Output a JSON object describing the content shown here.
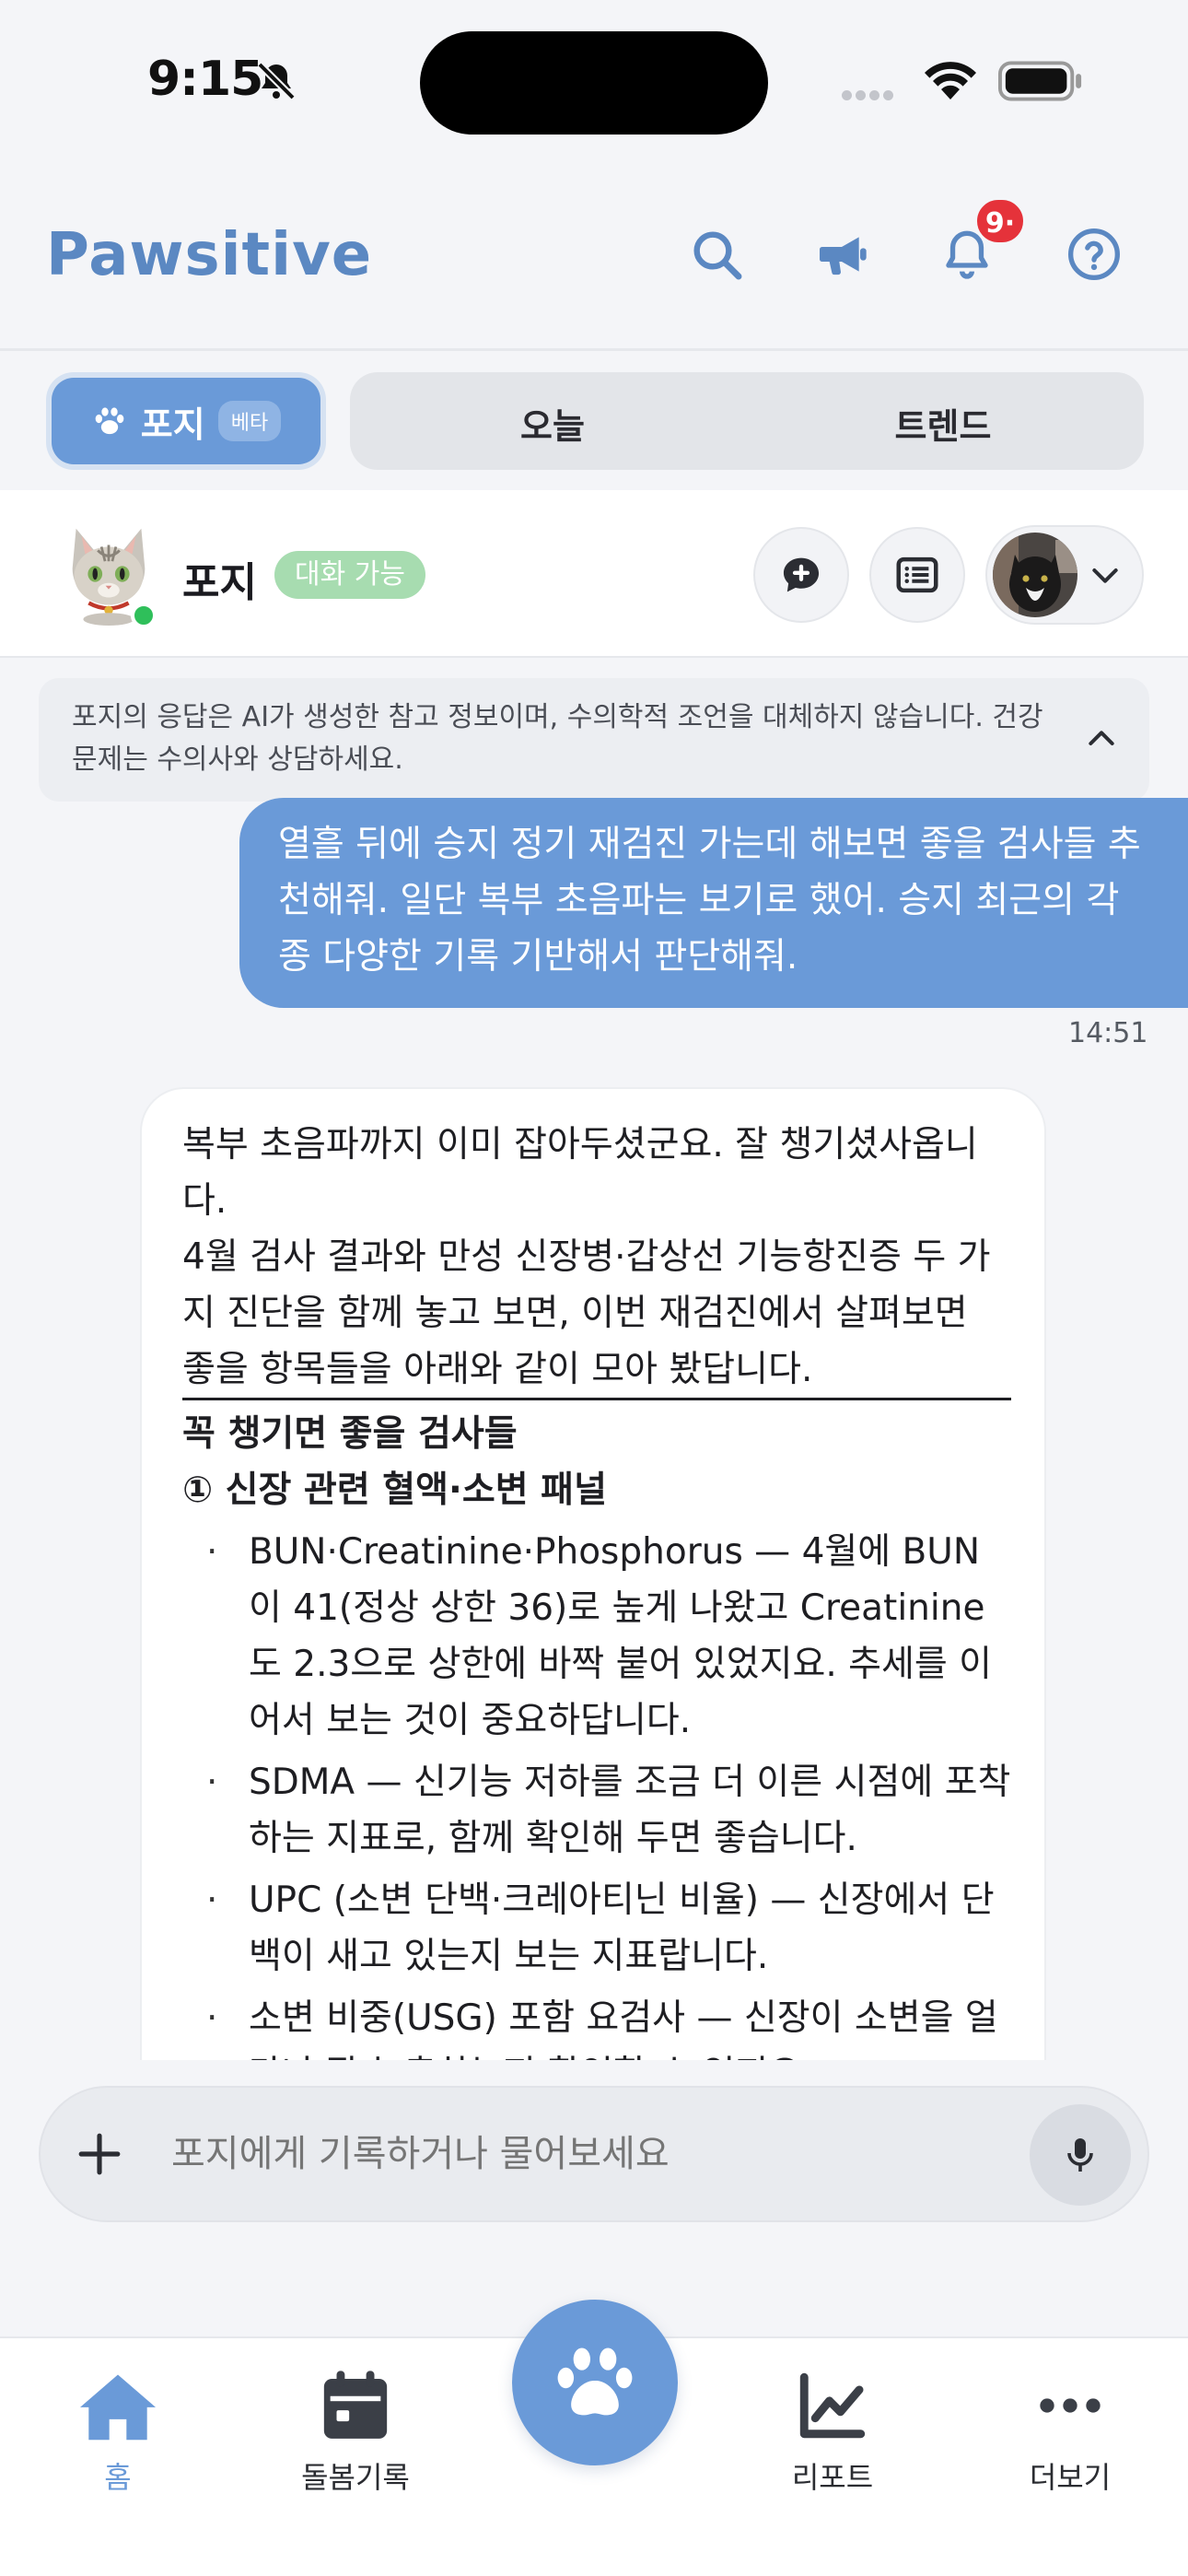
{
  "status_bar": {
    "time": "9:15"
  },
  "header": {
    "brand": "Pawsitive",
    "notification_count": "9·"
  },
  "tabs": {
    "poji_label": "포지",
    "beta_label": "베타",
    "today_label": "오늘",
    "trend_label": "트렌드"
  },
  "chat_header": {
    "bot_name": "포지",
    "status": "대화 가능"
  },
  "disclaimer": {
    "text": "포지의 응답은 AI가 생성한 참고 정보이며, 수의학적 조언을 대체하지 않습니다. 건강 문제는 수의사와 상담하세요."
  },
  "messages": {
    "user": {
      "text": "열흘 뒤에 승지 정기 재검진 가는데 해보면 좋을 검사들 추천해줘. 일단 복부 초음파는 보기로 했어. 승지 최근의 각종 다양한 기록 기반해서 판단해줘.",
      "time": "14:51"
    },
    "bot": {
      "intro": "복부 초음파까지 이미 잡아두셨군요. 잘 챙기셨사옵니다.",
      "para": "4월 검사 결과와 만성 신장병·갑상선 기능항진증 두 가지 진단을 함께 놓고 보면, 이번 재검진에서 살펴보면 좋을 항목들을 아래와 같이 모아 봤답니다.",
      "heading": "꼭 챙기면 좋을 검사들",
      "subheading": "① 신장 관련 혈액·소변 패널",
      "items": [
        "BUN·Creatinine·Phosphorus — 4월에 BUN이 41(정상 상한 36)로 높게 나왔고 Creatinine도 2.3으로 상한에 바짝 붙어 있었지요. 추세를 이어서 보는 것이 중요하답니다.",
        "SDMA — 신기능 저하를 조금 더 이른 시점에 포착하는 지표로, 함께 확인해 두면 좋습니다.",
        "UPC (소변 단백·크레아티닌 비율) — 신장에서 단백이 새고 있는지 보는 지표랍니다.",
        "소변 비중(USG) 포함 요검사 — 신장이 소변을 얼마나 잘 농축하는지 확인할 수 있지요."
      ]
    }
  },
  "composer": {
    "placeholder": "포지에게 기록하거나 물어보세요"
  },
  "bottom_nav": {
    "home": "홈",
    "care_log": "돌봄기록",
    "report": "리포트",
    "more": "더보기"
  },
  "colors": {
    "accent": "#6a9ad8",
    "brand": "#5b88c2",
    "online": "#2fbf5a",
    "badge": "#e5323a"
  }
}
